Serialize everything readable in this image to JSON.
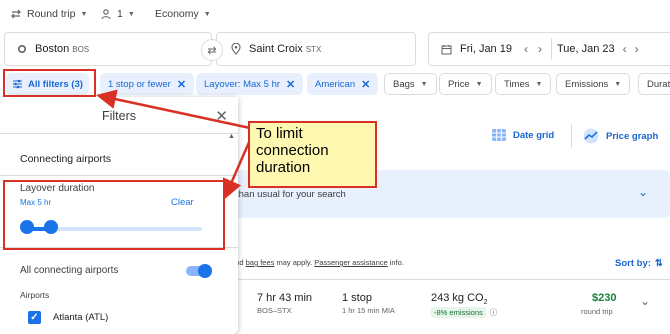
{
  "trip_options": {
    "trip_type": "Round trip",
    "passengers": "1",
    "cabin": "Economy"
  },
  "search": {
    "origin": "Boston",
    "origin_code": "BOS",
    "destination": "Saint Croix",
    "destination_code": "STX",
    "depart_date": "Fri, Jan 19",
    "return_date": "Tue, Jan 23"
  },
  "filters_bar": {
    "all_filters": "All filters (3)",
    "chips_active": [
      "1 stop or fewer",
      "Layover: Max 5 hr",
      "American"
    ],
    "chips": [
      "Bags",
      "Price",
      "Times",
      "Emissions",
      "Durati"
    ]
  },
  "panel": {
    "title": "Filters",
    "connecting_airports_heading": "Connecting airports",
    "layover_heading": "Layover duration",
    "layover_value": "Max 5 hr",
    "clear": "Clear",
    "all_connecting_airports": "All connecting airports",
    "airports_label": "Airports",
    "airport_item": "Atlanta (ATL)",
    "layover_slider_fraction": 0.15,
    "all_connecting_toggle_on": true,
    "airport_checked": true
  },
  "main": {
    "date_grid": "Date grid",
    "price_graph": "Price graph",
    "info_text": "than usual for your search",
    "bag_text_prefix": "and",
    "bag_fees": "bag fees",
    "bag_text_mid": "may apply.",
    "passenger_assistance": "Passenger assistance",
    "bag_text_suffix": "info.",
    "sort_by": "Sort by:"
  },
  "result": {
    "duration": "7 hr 43 min",
    "route": "BOS–STX",
    "stops": "1 stop",
    "layover": "1 hr 15 min MIA",
    "emissions": "243 kg CO",
    "emissions_sub": "2",
    "emissions_badge": "-8% emissions",
    "price": "$230",
    "price_note": "round trip"
  },
  "callout": {
    "text_line1": "To limit",
    "text_line2": "connection",
    "text_line3": "duration"
  },
  "colors": {
    "accent": "#1a73e8",
    "annotation_red": "#d93025",
    "callout_fill": "#fff8b0",
    "price_green": "#188038"
  }
}
